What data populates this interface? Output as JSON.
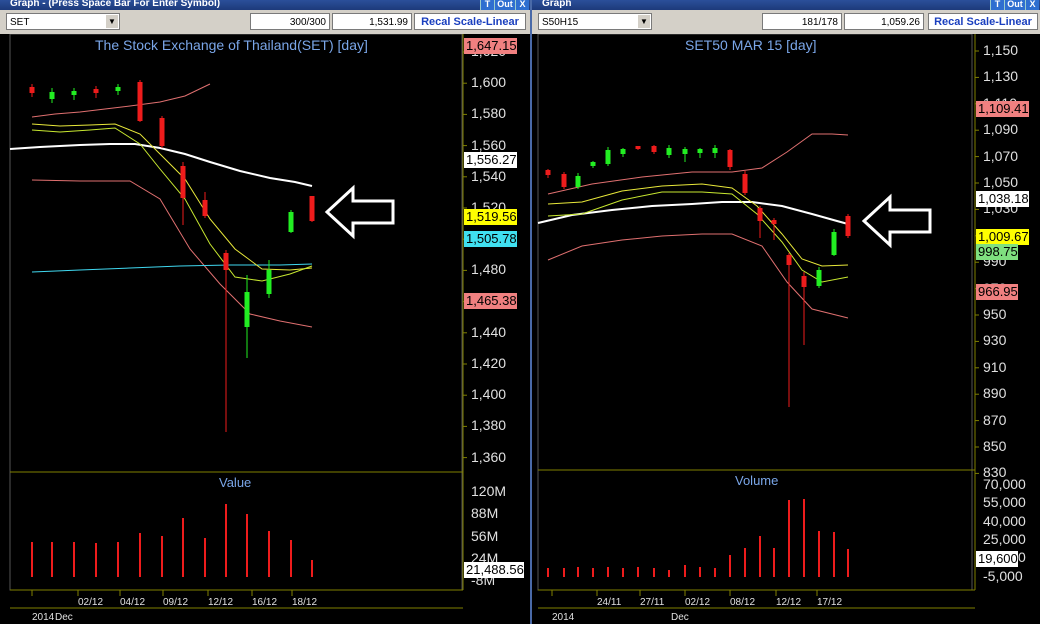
{
  "left": {
    "window_title": "Graph - (Press Space Bar For Enter Symbol)",
    "btn_t": "T",
    "btn_out": "Out",
    "btn_x": "X",
    "symbol": "SET",
    "count": "300/300",
    "price": "1,531.99",
    "recal": "Recal Scale-Linear",
    "chart_title": "The Stock Exchange of Thailand(SET) [day]",
    "volume_title": "Value",
    "y_ticks": [
      "1,620",
      "1,600",
      "1,580",
      "1,560",
      "1,540",
      "1,520",
      "1,500",
      "1,480",
      "1,460",
      "1,440",
      "1,420",
      "1,400",
      "1,380",
      "1,360"
    ],
    "tags": [
      {
        "text": "1,647.15",
        "bg": "#f08080"
      },
      {
        "text": "1,556.27",
        "bg": "#ffffff"
      },
      {
        "text": "1,519.56",
        "bg": "#ffff00"
      },
      {
        "text": "1,505.78",
        "bg": "#40e0f0"
      },
      {
        "text": "1,465.38",
        "bg": "#f08080"
      }
    ],
    "vol_ticks": [
      "120M",
      "88M",
      "56M",
      "24M",
      "-8M"
    ],
    "vol_tag": "21,488.56",
    "x_labels": [
      "02/12",
      "04/12",
      "09/12",
      "12/12",
      "16/12",
      "18/12"
    ],
    "year_label": "2014",
    "month_label": "Dec"
  },
  "right": {
    "window_title": "Graph",
    "btn_t": "T",
    "btn_out": "Out",
    "btn_x": "X",
    "symbol": "S50H15",
    "count": "181/178",
    "price": "1,059.26",
    "recal": "Recal Scale-Linear",
    "chart_title": "SET50 MAR 15   [day]",
    "volume_title": "Volume",
    "y_ticks": [
      "1,150",
      "1,130",
      "1,110",
      "1,090",
      "1,070",
      "1,050",
      "1,030",
      "1,010",
      "990",
      "970",
      "950",
      "930",
      "910",
      "890",
      "870",
      "850",
      "830"
    ],
    "tags": [
      {
        "text": "1,109.41",
        "bg": "#f08080"
      },
      {
        "text": "1,038.18",
        "bg": "#ffffff"
      },
      {
        "text": "1,009.67",
        "bg": "#ffff00"
      },
      {
        "text": "998.75",
        "bg": "#7fe07f"
      },
      {
        "text": "966.95",
        "bg": "#f08080"
      }
    ],
    "vol_ticks": [
      "70,000",
      "55,000",
      "40,000",
      "25,000",
      "10,000",
      "-5,000"
    ],
    "vol_tag": "19,600",
    "x_labels": [
      "24/11",
      "27/11",
      "02/12",
      "08/12",
      "12/12",
      "17/12"
    ],
    "year_label": "2014",
    "month_label": "Dec"
  },
  "colors": {
    "up": "#22ee22",
    "down": "#ee1c1c",
    "ma_slow": "#ffffff",
    "ma_fast": "#e8e83a",
    "band": "#e07070",
    "line_cyan": "#40d8f0",
    "grid": "#808000",
    "axis_text": "#e0e0e0",
    "title": "#7aa6e8"
  }
}
